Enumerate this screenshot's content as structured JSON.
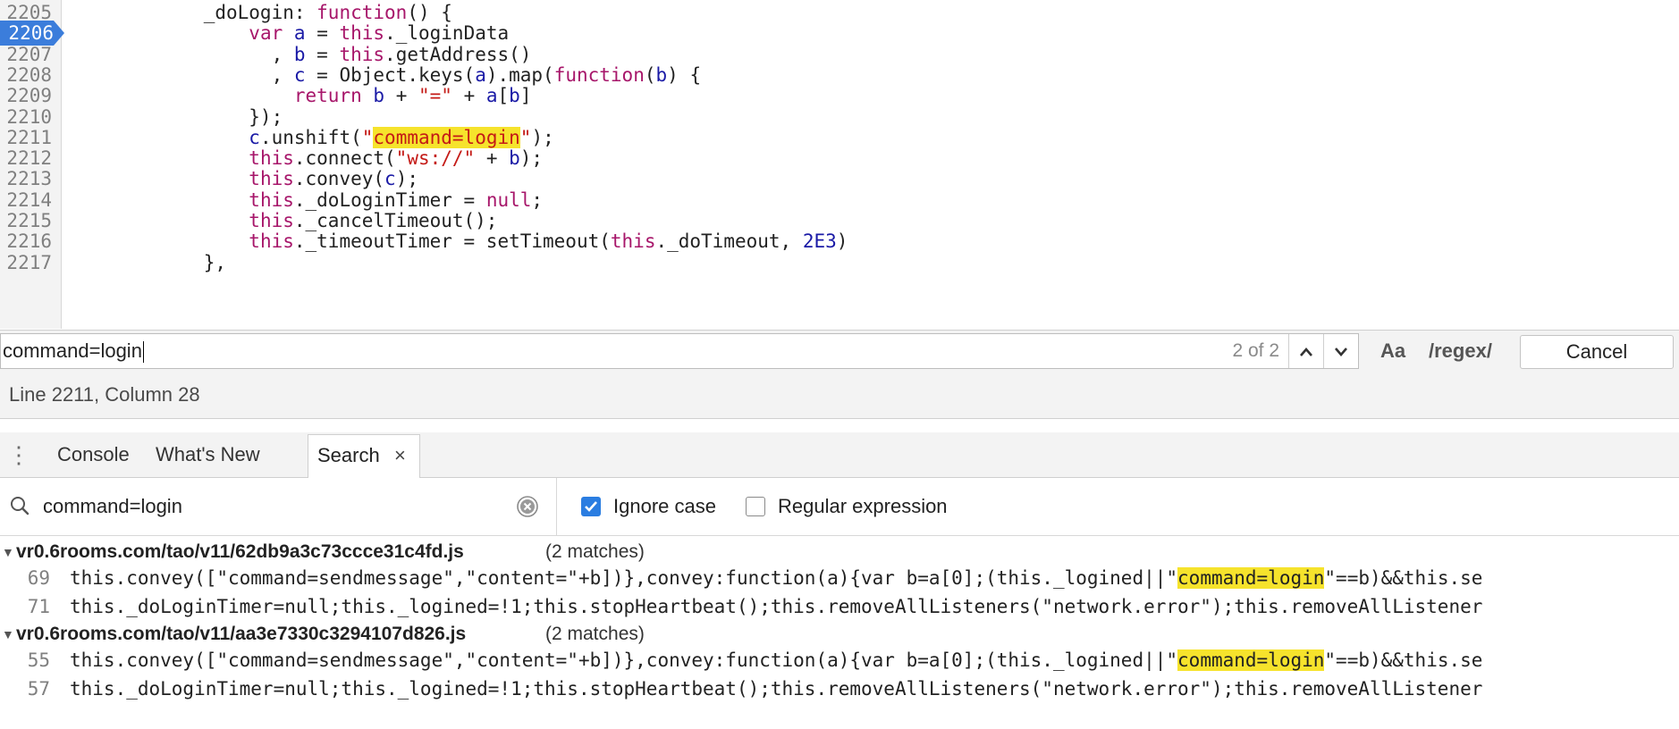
{
  "editor": {
    "lines": [
      {
        "num": "2205",
        "active": false,
        "parts": [
          [
            "",
            "            _doLogin: "
          ],
          [
            "kw",
            "function"
          ],
          [
            "",
            "() {"
          ]
        ]
      },
      {
        "num": "2206",
        "active": true,
        "parts": [
          [
            "",
            "                "
          ],
          [
            "kw",
            "var"
          ],
          [
            "",
            " "
          ],
          [
            "var",
            "a"
          ],
          [
            "",
            " = "
          ],
          [
            "kw",
            "this"
          ],
          [
            "",
            "._loginData"
          ]
        ]
      },
      {
        "num": "2207",
        "active": false,
        "parts": [
          [
            "",
            "                  , "
          ],
          [
            "var",
            "b"
          ],
          [
            "",
            " = "
          ],
          [
            "kw",
            "this"
          ],
          [
            "",
            ".getAddress()"
          ]
        ]
      },
      {
        "num": "2208",
        "active": false,
        "parts": [
          [
            "",
            "                  , "
          ],
          [
            "var",
            "c"
          ],
          [
            "",
            " = Object.keys("
          ],
          [
            "var",
            "a"
          ],
          [
            "",
            ").map("
          ],
          [
            "kw",
            "function"
          ],
          [
            "",
            "("
          ],
          [
            "var",
            "b"
          ],
          [
            "",
            ") {"
          ]
        ]
      },
      {
        "num": "2209",
        "active": false,
        "parts": [
          [
            "",
            "                    "
          ],
          [
            "kw",
            "return"
          ],
          [
            "",
            " "
          ],
          [
            "var",
            "b"
          ],
          [
            "",
            " + "
          ],
          [
            "str",
            "\"=\""
          ],
          [
            "",
            " + "
          ],
          [
            "var",
            "a"
          ],
          [
            "",
            "["
          ],
          [
            "var",
            "b"
          ],
          [
            "",
            "]"
          ]
        ]
      },
      {
        "num": "2210",
        "active": false,
        "parts": [
          [
            "",
            "                });"
          ]
        ]
      },
      {
        "num": "2211",
        "active": false,
        "parts": [
          [
            "",
            "                "
          ],
          [
            "var",
            "c"
          ],
          [
            "",
            ".unshift("
          ],
          [
            "str",
            "\""
          ],
          [
            "strhl",
            "command=login"
          ],
          [
            "str",
            "\""
          ],
          [
            "",
            ");"
          ]
        ]
      },
      {
        "num": "2212",
        "active": false,
        "parts": [
          [
            "",
            "                "
          ],
          [
            "kw",
            "this"
          ],
          [
            "",
            ".connect("
          ],
          [
            "str",
            "\"ws://\""
          ],
          [
            "",
            " + "
          ],
          [
            "var",
            "b"
          ],
          [
            "",
            ");"
          ]
        ]
      },
      {
        "num": "2213",
        "active": false,
        "parts": [
          [
            "",
            "                "
          ],
          [
            "kw",
            "this"
          ],
          [
            "",
            ".convey("
          ],
          [
            "var",
            "c"
          ],
          [
            "",
            ");"
          ]
        ]
      },
      {
        "num": "2214",
        "active": false,
        "parts": [
          [
            "",
            "                "
          ],
          [
            "kw",
            "this"
          ],
          [
            "",
            "._doLoginTimer = "
          ],
          [
            "kw",
            "null"
          ],
          [
            "",
            ";"
          ]
        ]
      },
      {
        "num": "2215",
        "active": false,
        "parts": [
          [
            "",
            "                "
          ],
          [
            "kw",
            "this"
          ],
          [
            "",
            "._cancelTimeout();"
          ]
        ]
      },
      {
        "num": "2216",
        "active": false,
        "parts": [
          [
            "",
            "                "
          ],
          [
            "kw",
            "this"
          ],
          [
            "",
            "._timeoutTimer = setTimeout("
          ],
          [
            "kw",
            "this"
          ],
          [
            "",
            "._doTimeout, "
          ],
          [
            "num",
            "2E3"
          ],
          [
            "",
            ")"
          ]
        ]
      },
      {
        "num": "2217",
        "active": false,
        "parts": [
          [
            "",
            "            },"
          ]
        ]
      }
    ]
  },
  "findbar": {
    "query": "command=login",
    "count": "2 of 2",
    "prev_glyph": "⌃",
    "next_glyph": "⌄",
    "case_label": "Aa",
    "regex_label": "/regex/",
    "cancel_label": "Cancel"
  },
  "status": {
    "text": "Line 2211, Column 28"
  },
  "drawer": {
    "menu_glyph": "⋮",
    "tabs": {
      "console": "Console",
      "whats_new": "What's New",
      "search": "Search",
      "close_glyph": "×"
    }
  },
  "search": {
    "query": "command=login",
    "ignore_case_label": "Ignore case",
    "ignore_case_checked": true,
    "regex_label": "Regular expression",
    "regex_checked": false
  },
  "results": [
    {
      "file": "vr0.6rooms.com/tao/v11/62db9a3c73ccce31c4fd.js",
      "count": "(2 matches)",
      "matches": [
        {
          "line": "69",
          "before": "this.convey([\"command=sendmessage\",\"content=\"+b])},convey:function(a){var b=a[0];(this._logined||\"",
          "match": "command=login",
          "after": "\"==b)&&this.se"
        },
        {
          "line": "71",
          "before": "this._doLoginTimer=null;this._logined=!1;this.stopHeartbeat();this.removeAllListeners(\"network.error\");this.removeAllListener",
          "match": "",
          "after": ""
        }
      ]
    },
    {
      "file": "vr0.6rooms.com/tao/v11/aa3e7330c3294107d826.js",
      "count": "(2 matches)",
      "matches": [
        {
          "line": "55",
          "before": "this.convey([\"command=sendmessage\",\"content=\"+b])},convey:function(a){var b=a[0];(this._logined||\"",
          "match": "command=login",
          "after": "\"==b)&&this.se"
        },
        {
          "line": "57",
          "before": "this._doLoginTimer=null;this._logined=!1;this.stopHeartbeat();this.removeAllListeners(\"network.error\");this.removeAllListener",
          "match": "",
          "after": ""
        }
      ]
    }
  ],
  "colors": {
    "highlight": "#f6e32c",
    "keyword": "#a7166a",
    "string": "#c41a16",
    "number": "#1a1aa6",
    "active_line": "#3b7ddb",
    "checkbox": "#2a7de1"
  },
  "icons": {
    "search": "search-icon",
    "clear": "clear-icon",
    "prev": "chevron-up-icon",
    "next": "chevron-down-icon",
    "menu": "more-vertical-icon",
    "close": "close-icon",
    "breakpoint": "line-marker-icon",
    "expand": "triangle-down-icon"
  }
}
